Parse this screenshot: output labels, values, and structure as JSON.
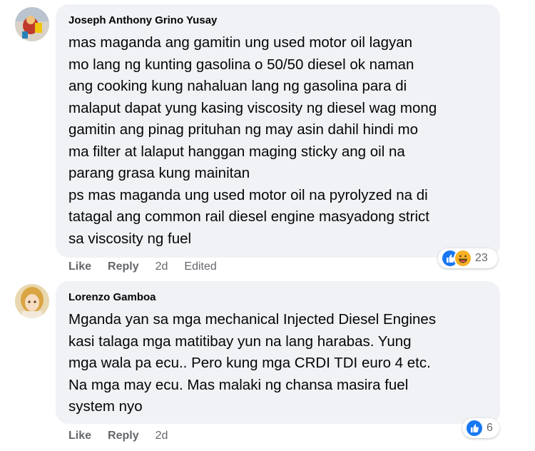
{
  "comments": [
    {
      "author": "Joseph Anthony Grino Yusay",
      "lines": [
        "mas maganda ang gamitin ung used motor oil lagyan",
        "mo lang ng kunting gasolina o 50/50 diesel ok naman",
        "ang cooking kung nahaluan lang ng gasolina para di",
        "malaput dapat yung kasing viscosity ng diesel wag mong",
        "gamitin ang pinag prituhan ng may asin dahil hindi mo",
        "ma filter at lalaput hanggan maging sticky ang oil na",
        "parang grasa kung mainitan",
        "ps mas maganda ung used motor oil na pyrolyzed na di",
        "tatagal ang common rail diesel engine masyadong strict",
        "sa viscosity ng fuel"
      ],
      "actions": {
        "like": "Like",
        "reply": "Reply",
        "time": "2d",
        "edited": "Edited"
      },
      "reactions": {
        "count": "23",
        "icons": [
          "like-icon",
          "haha-icon"
        ]
      }
    },
    {
      "author": "Lorenzo Gamboa",
      "lines": [
        "Mganda yan sa mga mechanical Injected Diesel Engines",
        "kasi talaga mga matitibay yun na lang harabas. Yung",
        "mga wala pa ecu.. Pero kung mga CRDI TDI euro 4 etc.",
        "Na mga may ecu. Mas malaki ng chansa masira fuel",
        "system nyo"
      ],
      "actions": {
        "like": "Like",
        "reply": "Reply",
        "time": "2d"
      },
      "reactions": {
        "count": "6",
        "icons": [
          "like-icon"
        ]
      }
    }
  ]
}
